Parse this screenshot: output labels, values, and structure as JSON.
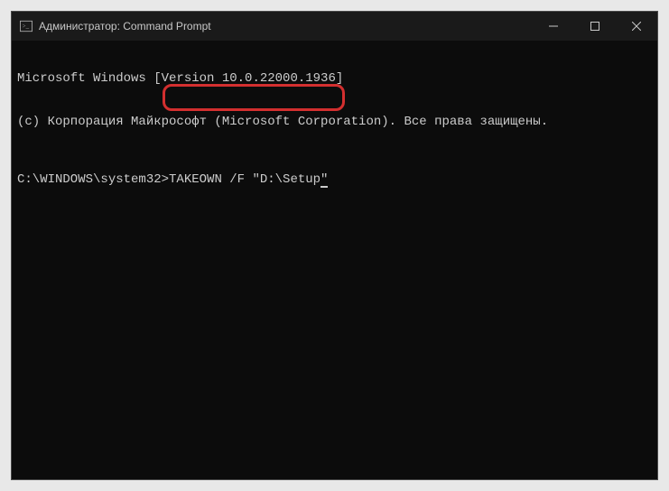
{
  "titlebar": {
    "text": "Администратор: Command Prompt"
  },
  "terminal": {
    "line1": "Microsoft Windows [Version 10.0.22000.1936]",
    "line2": "(c) Корпорация Майкрософт (Microsoft Corporation). Все права защищены.",
    "prompt": "C:\\WINDOWS\\system32>",
    "command": "TAKEOWN /F \"D:\\Setup\""
  },
  "highlight_color": "#d32f2f"
}
